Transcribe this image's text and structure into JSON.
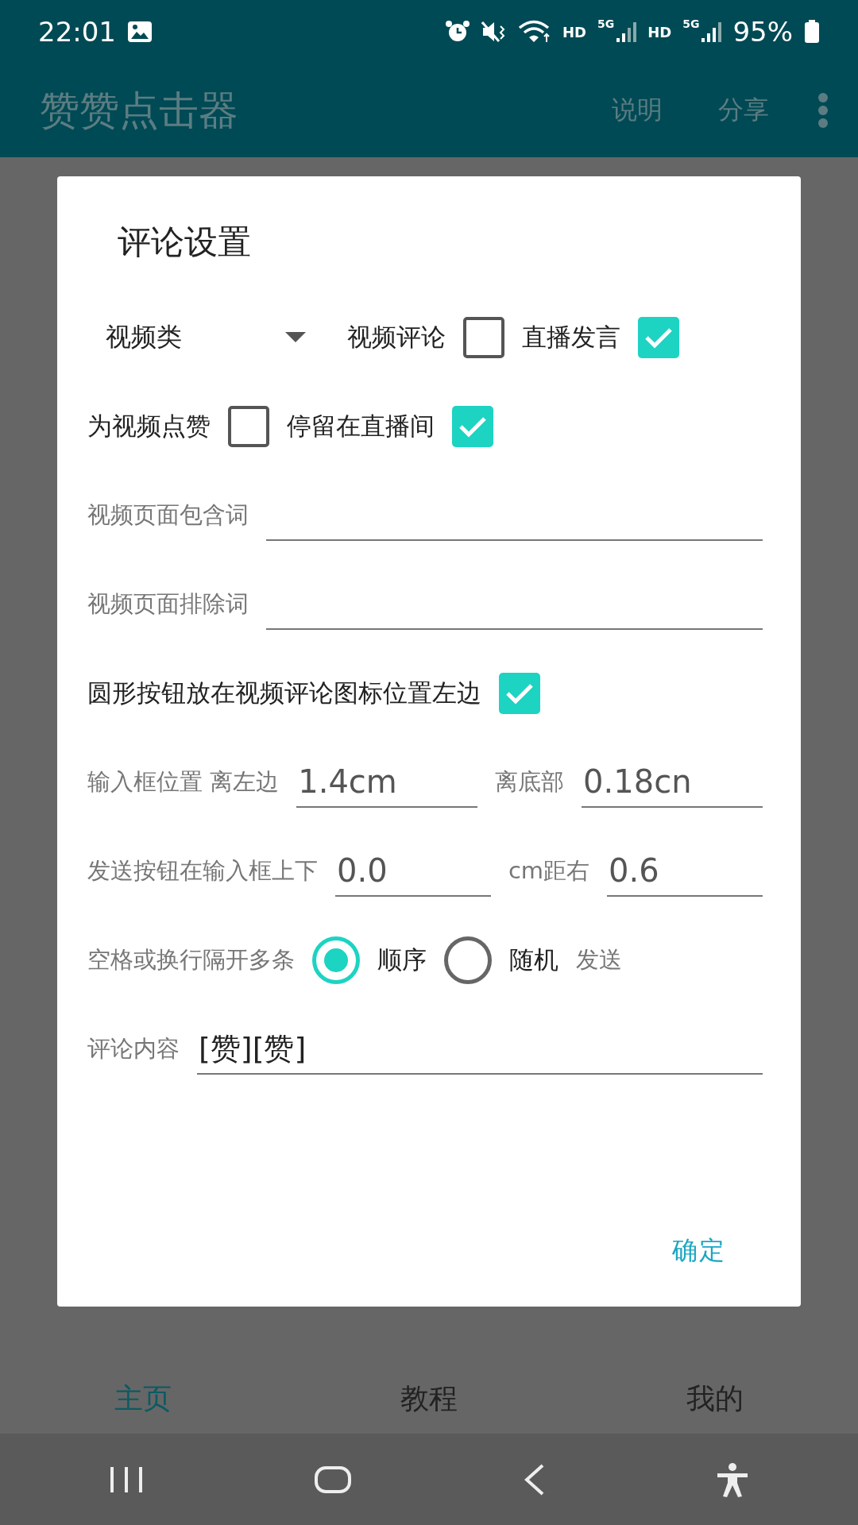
{
  "status_bar": {
    "time": "22:01",
    "network_labels": [
      "HD",
      "5G",
      "HD",
      "5G"
    ],
    "battery": "95%"
  },
  "app_bar": {
    "title": "赞赞点击器",
    "actions": [
      "说明",
      "分享"
    ]
  },
  "dialog": {
    "title": "评论设置",
    "rows": [
      {
        "items": [
          {
            "kind": "spinner",
            "value": "视频类"
          },
          {
            "kind": "check",
            "label": "视频评论",
            "checked": false
          },
          {
            "kind": "check",
            "label": "直播发言",
            "checked": true
          }
        ]
      },
      {
        "items": [
          {
            "kind": "check",
            "label": "为视频点赞",
            "checked": false
          },
          {
            "kind": "check",
            "label": "停留在直播间",
            "checked": true
          }
        ]
      },
      {
        "items": [
          {
            "kind": "label",
            "text": "视频页面包含词"
          },
          {
            "kind": "input"
          }
        ]
      },
      {
        "items": [
          {
            "kind": "label",
            "text": "视频页面排除词"
          },
          {
            "kind": "input"
          }
        ]
      },
      {
        "items": [
          {
            "kind": "check",
            "label": "圆形按钮放在视频评论图标位置左边",
            "checked": true
          }
        ]
      },
      {
        "items": [
          {
            "kind": "label",
            "text": "输入框位置 离左边"
          },
          {
            "kind": "input",
            "value": "1.4cm"
          },
          {
            "kind": "label",
            "text": "离底部"
          },
          {
            "kind": "input",
            "value": "0.18cn"
          }
        ]
      },
      {
        "items": [
          {
            "kind": "label",
            "text": "发送按钮在输入框上下"
          },
          {
            "kind": "input",
            "value": "0.0"
          },
          {
            "kind": "label",
            "text": "cm距右"
          },
          {
            "kind": "input",
            "value": "0.6"
          }
        ]
      },
      {
        "items": [
          {
            "kind": "label",
            "text": "空格或换行隔开多条"
          },
          {
            "kind": "radio",
            "label": "顺序",
            "selected": true
          },
          {
            "kind": "radio",
            "label": "随机",
            "selected": false
          },
          {
            "kind": "label",
            "text": "发送"
          }
        ]
      },
      {
        "items": [
          {
            "kind": "label",
            "text": "评论内容"
          },
          {
            "kind": "input",
            "value": "[赞][赞]"
          }
        ]
      }
    ],
    "button": "确定"
  },
  "bottom_tabs": [
    {
      "label": "主页",
      "selected": true
    },
    {
      "label": "教程",
      "selected": false
    },
    {
      "label": "我的",
      "selected": false
    }
  ]
}
